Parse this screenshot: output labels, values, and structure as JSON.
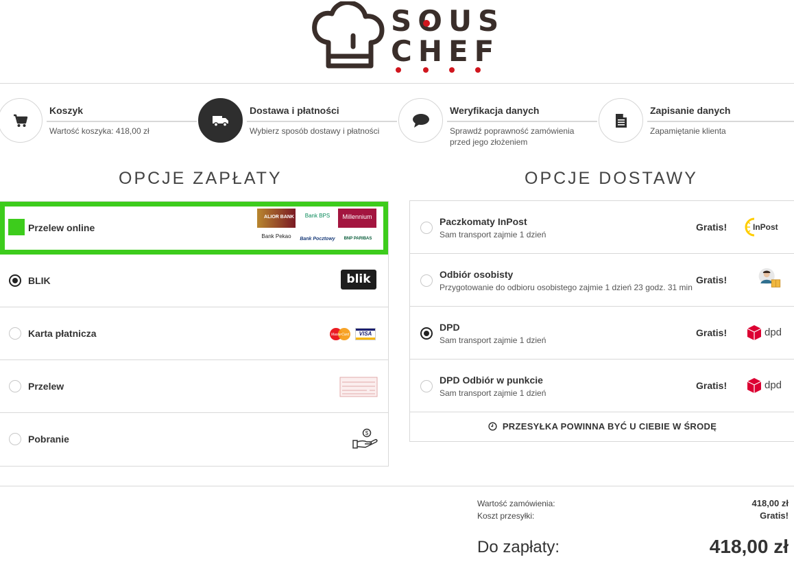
{
  "brand": {
    "line1": "SOUS",
    "line2": "CHEF",
    "accent_color": "#d0161e",
    "dark_color": "#3a2e2a"
  },
  "steps": [
    {
      "title": "Koszyk",
      "subtitle": "Wartość koszyka: 418,00 zł",
      "subtitle2": "",
      "icon": "cart-icon",
      "active": false
    },
    {
      "title": "Dostawa i płatności",
      "subtitle": "Wybierz sposób dostawy i płatności",
      "subtitle2": "",
      "icon": "truck-icon",
      "active": true
    },
    {
      "title": "Weryfikacja danych",
      "subtitle": "Sprawdź poprawność zamówienia",
      "subtitle2": "przed jego złożeniem",
      "icon": "speech-bubble-icon",
      "active": false
    },
    {
      "title": "Zapisanie danych",
      "subtitle": "Zapamiętanie klienta",
      "subtitle2": "",
      "icon": "document-icon",
      "active": false
    }
  ],
  "payment": {
    "title": "OPCJE ZAPŁATY",
    "highlight_color": "#3dcc1c",
    "options": [
      {
        "label": "Przelew online",
        "selected": true,
        "icon": "bank-logos"
      },
      {
        "label": "BLIK",
        "selected": true,
        "checked": true,
        "icon": "blik-logo"
      },
      {
        "label": "Karta płatnicza",
        "selected": false,
        "icon": "card-logos"
      },
      {
        "label": "Przelew",
        "selected": false,
        "icon": "transfer-form-icon"
      },
      {
        "label": "Pobranie",
        "selected": false,
        "icon": "cash-hand-icon"
      }
    ],
    "banks": {
      "alior": "ALIOR BANK",
      "bps": "Bank BPS",
      "millennium": "Millennium",
      "pekao": "Bank Pekao",
      "pocztowy": "Bank Pocztowy",
      "bnp": "BNP PARIBAS"
    },
    "blik_text": "blik",
    "mastercard_text": "MasterCard",
    "visa_text": "VISA"
  },
  "delivery": {
    "title": "OPCJE DOSTAWY",
    "options": [
      {
        "name": "Paczkomaty InPost",
        "sub": "Sam transport zajmie 1 dzień",
        "price": "Gratis!",
        "checked": false,
        "logo": "inpost-logo"
      },
      {
        "name": "Odbiór osobisty",
        "sub": "Przygotowanie do odbioru osobistego zajmie 1 dzień 23 godz. 31 min",
        "price": "Gratis!",
        "checked": false,
        "logo": "person-package-icon"
      },
      {
        "name": "DPD",
        "sub": "Sam transport zajmie 1 dzień",
        "price": "Gratis!",
        "checked": true,
        "logo": "dpd-logo"
      },
      {
        "name": "DPD Odbiór w punkcie",
        "sub": "Sam transport zajmie 1 dzień",
        "price": "Gratis!",
        "checked": false,
        "logo": "dpd-logo"
      }
    ],
    "inpost_text": "InPost",
    "dpd_text": "dpd",
    "dpd_color": "#dc0032",
    "eta": "PRZESYŁKA POWINNA BYĆ U CIEBIE W ŚRODĘ"
  },
  "summary": {
    "order_value_label": "Wartość zamówienia:",
    "order_value": "418,00 zł",
    "shipping_label": "Koszt przesyłki:",
    "shipping_value": "Gratis!",
    "total_label": "Do zapłaty:",
    "total_value": "418,00 zł"
  }
}
